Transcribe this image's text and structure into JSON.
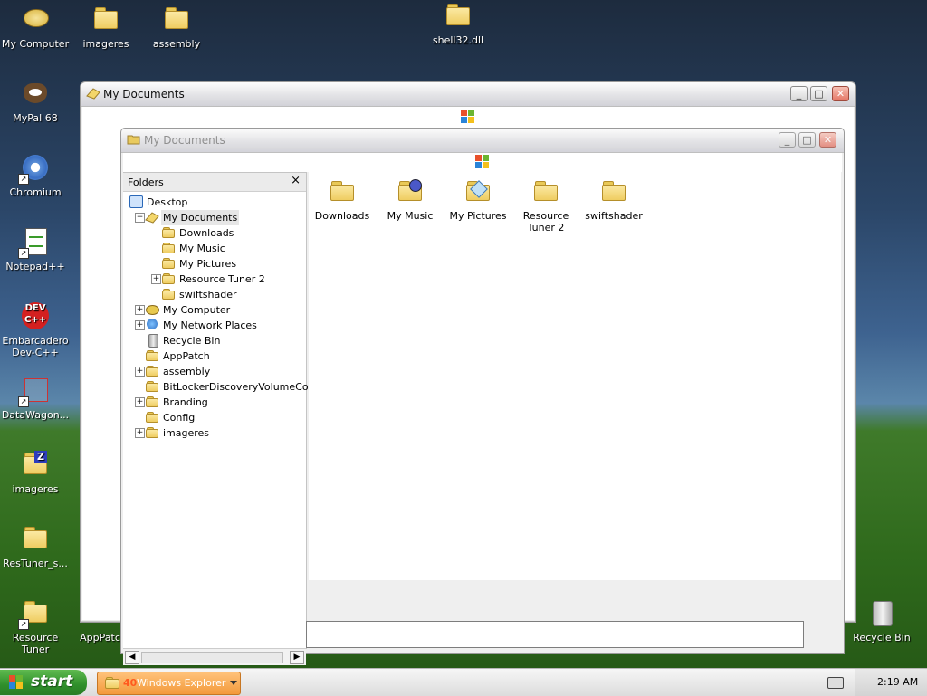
{
  "desktop": {
    "icons_left": [
      {
        "label": "My Computer",
        "icon": "computer-icon"
      },
      {
        "label": "imageres",
        "icon": "folder-icon"
      },
      {
        "label": "assembly",
        "icon": "folder-icon"
      },
      {
        "label": "shell32.dll",
        "icon": "folder-icon"
      },
      {
        "label": "MyPal 68",
        "icon": "mypal-icon"
      },
      {
        "label": "Chromium",
        "icon": "chromium-icon"
      },
      {
        "label": "Notepad++",
        "icon": "notepad-icon"
      },
      {
        "label": "Embarcadero Dev-C++",
        "icon": "devcpp-icon"
      },
      {
        "label": "DataWagon...",
        "icon": "datawagon-icon"
      },
      {
        "label": "imageres",
        "icon": "zip-folder-icon"
      },
      {
        "label": "ResTuner_s...",
        "icon": "folder-icon"
      },
      {
        "label": "Resource Tuner",
        "icon": "folder-icon"
      },
      {
        "label": "AppPatch",
        "icon": "folder-icon"
      },
      {
        "label": "Recycle Bin",
        "icon": "recycle-bin-icon"
      }
    ]
  },
  "outer_window": {
    "title": "My Documents"
  },
  "inner_window": {
    "title": "My Documents",
    "folders_pane": {
      "header": "Folders",
      "close": "×",
      "tree": [
        {
          "label": "Desktop",
          "level": 0,
          "expander": "",
          "icon": "desktop-icon"
        },
        {
          "label": "My Documents",
          "level": 1,
          "expander": "−",
          "icon": "my-documents-icon",
          "selected": true
        },
        {
          "label": "Downloads",
          "level": 2,
          "expander": "",
          "icon": "folder-icon"
        },
        {
          "label": "My Music",
          "level": 2,
          "expander": "",
          "icon": "music-folder-icon"
        },
        {
          "label": "My Pictures",
          "level": 2,
          "expander": "",
          "icon": "pictures-folder-icon"
        },
        {
          "label": "Resource Tuner 2",
          "level": 2,
          "expander": "+",
          "icon": "folder-icon"
        },
        {
          "label": "swiftshader",
          "level": 2,
          "expander": "",
          "icon": "folder-icon"
        },
        {
          "label": "My Computer",
          "level": 1,
          "expander": "+",
          "icon": "computer-icon"
        },
        {
          "label": "My Network Places",
          "level": 1,
          "expander": "+",
          "icon": "network-icon"
        },
        {
          "label": "Recycle Bin",
          "level": 1,
          "expander": "",
          "icon": "recycle-bin-icon"
        },
        {
          "label": "AppPatch",
          "level": 1,
          "expander": "",
          "icon": "folder-icon"
        },
        {
          "label": "assembly",
          "level": 1,
          "expander": "+",
          "icon": "folder-icon"
        },
        {
          "label": "BitLockerDiscoveryVolumeContents",
          "level": 1,
          "expander": "",
          "icon": "folder-icon"
        },
        {
          "label": "Branding",
          "level": 1,
          "expander": "+",
          "icon": "folder-icon"
        },
        {
          "label": "Config",
          "level": 1,
          "expander": "",
          "icon": "folder-icon"
        },
        {
          "label": "imageres",
          "level": 1,
          "expander": "+",
          "icon": "folder-icon"
        }
      ]
    },
    "files": [
      {
        "label": "Downloads",
        "icon": "folder-icon"
      },
      {
        "label": "My Music",
        "icon": "music-folder-icon"
      },
      {
        "label": "My Pictures",
        "icon": "pictures-folder-icon"
      },
      {
        "label": "Resource Tuner 2",
        "icon": "folder-icon"
      },
      {
        "label": "swiftshader",
        "icon": "folder-icon"
      }
    ]
  },
  "taskbar": {
    "start_label": "start",
    "task_count": "40",
    "task_label": "Windows Explorer",
    "clock": "2:19 AM"
  },
  "colors": {
    "folder": "#efcd62",
    "start": "#2f8f2b",
    "task": "#f39a3b",
    "close": "#e57766"
  }
}
